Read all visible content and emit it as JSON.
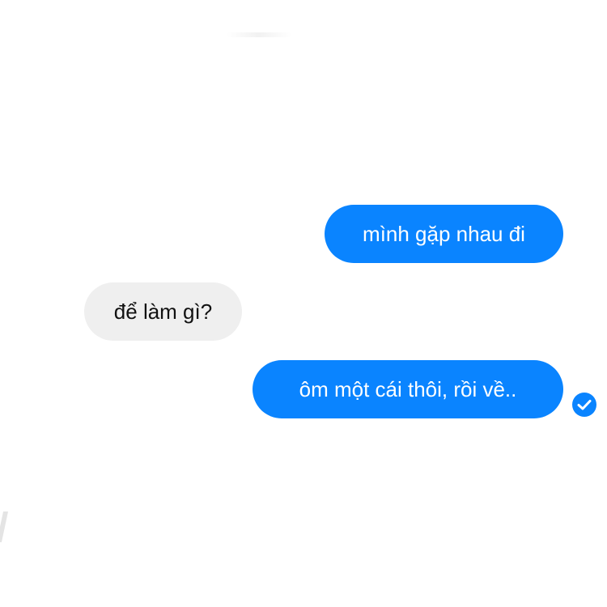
{
  "messages": [
    {
      "text": "mình gặp nhau đi",
      "direction": "outgoing"
    },
    {
      "text": "để làm gì?",
      "direction": "incoming"
    },
    {
      "text": "ôm một cái thôi, rồi về..",
      "direction": "outgoing"
    }
  ],
  "read_receipt": {
    "icon": "check-circle-icon",
    "color": "#0a84ff"
  },
  "colors": {
    "outgoing_bubble": "#0a84ff",
    "incoming_bubble": "#efefef",
    "background": "#ffffff"
  }
}
